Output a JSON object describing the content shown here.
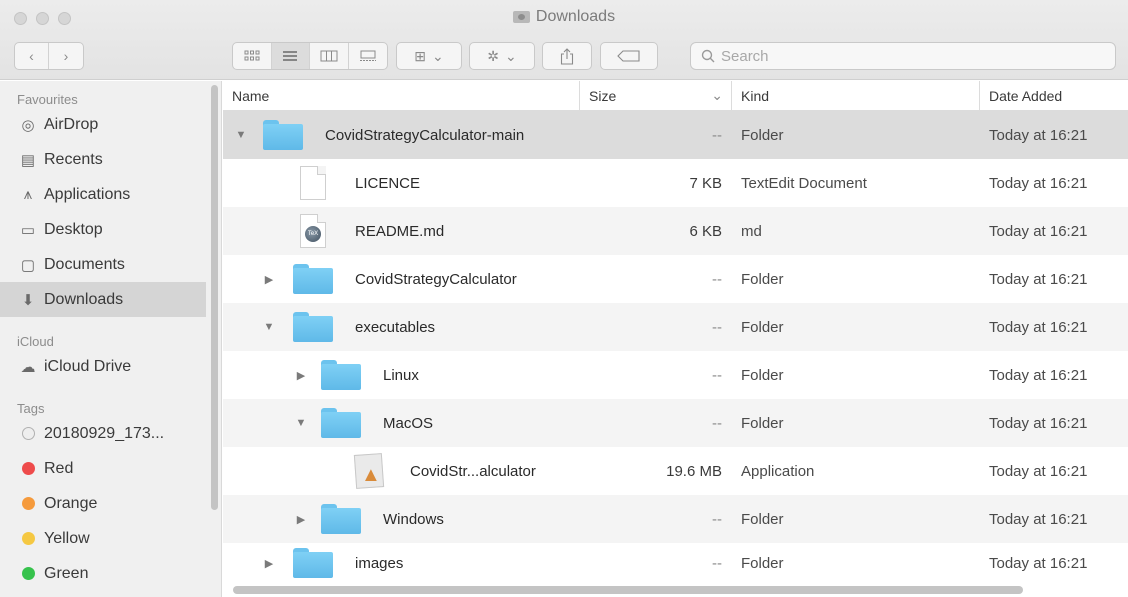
{
  "window": {
    "title": "Downloads"
  },
  "toolbar": {
    "back_glyph": "‹",
    "forward_glyph": "›",
    "view_icons": [
      "icon-view-icon",
      "list-view-icon",
      "column-view-icon",
      "gallery-view-icon"
    ],
    "group_glyph": "⊞",
    "action_glyph": "✲",
    "chevron": "⌄",
    "share_glyph": "⇧",
    "tag_glyph": "⬭",
    "search_placeholder": "Search",
    "search_glyph": "⌕"
  },
  "sidebar": {
    "sections": [
      {
        "heading": "Favourites",
        "items": [
          {
            "label": "AirDrop",
            "icon": "◎",
            "icon_name": "airdrop-icon"
          },
          {
            "label": "Recents",
            "icon": "▤",
            "icon_name": "recents-icon"
          },
          {
            "label": "Applications",
            "icon": "⩚",
            "icon_name": "applications-icon"
          },
          {
            "label": "Desktop",
            "icon": "▭",
            "icon_name": "desktop-icon"
          },
          {
            "label": "Documents",
            "icon": "▢",
            "icon_name": "documents-icon"
          },
          {
            "label": "Downloads",
            "icon": "⬇",
            "icon_name": "downloads-icon"
          }
        ]
      },
      {
        "heading": "iCloud",
        "items": [
          {
            "label": "iCloud Drive",
            "icon": "☁",
            "icon_name": "cloud-icon"
          }
        ]
      },
      {
        "heading": "Tags",
        "items": [
          {
            "label": "20180929_173...",
            "color": "#e6e6e6"
          },
          {
            "label": "Red",
            "color": "#ee4b4b"
          },
          {
            "label": "Orange",
            "color": "#f59a3c"
          },
          {
            "label": "Yellow",
            "color": "#f5c842"
          },
          {
            "label": "Green",
            "color": "#36c24c"
          }
        ]
      }
    ]
  },
  "columns": {
    "name": "Name",
    "size": "Size",
    "kind": "Kind",
    "date": "Date Added",
    "sort_glyph": "⌄"
  },
  "files": [
    {
      "name": "CovidStrategyCalculator-main",
      "size": "--",
      "kind": "Folder",
      "date": "Today at 16:21"
    },
    {
      "name": "LICENCE",
      "size": "7 KB",
      "kind": "TextEdit Document",
      "date": "Today at 16:21"
    },
    {
      "name": "README.md",
      "size": "6 KB",
      "kind": "md",
      "date": "Today at 16:21",
      "badge": "TeX"
    },
    {
      "name": "CovidStrategyCalculator",
      "size": "--",
      "kind": "Folder",
      "date": "Today at 16:21"
    },
    {
      "name": "executables",
      "size": "--",
      "kind": "Folder",
      "date": "Today at 16:21"
    },
    {
      "name": "Linux",
      "size": "--",
      "kind": "Folder",
      "date": "Today at 16:21"
    },
    {
      "name": "MacOS",
      "size": "--",
      "kind": "Folder",
      "date": "Today at 16:21"
    },
    {
      "name": "CovidStr...alculator",
      "size": "19.6 MB",
      "kind": "Application",
      "date": "Today at 16:21"
    },
    {
      "name": "Windows",
      "size": "--",
      "kind": "Folder",
      "date": "Today at 16:21"
    },
    {
      "name": "images",
      "size": "--",
      "kind": "Folder",
      "date": "Today at 16:21"
    }
  ],
  "disclosure": {
    "expanded": "▼",
    "collapsed": "▶"
  }
}
